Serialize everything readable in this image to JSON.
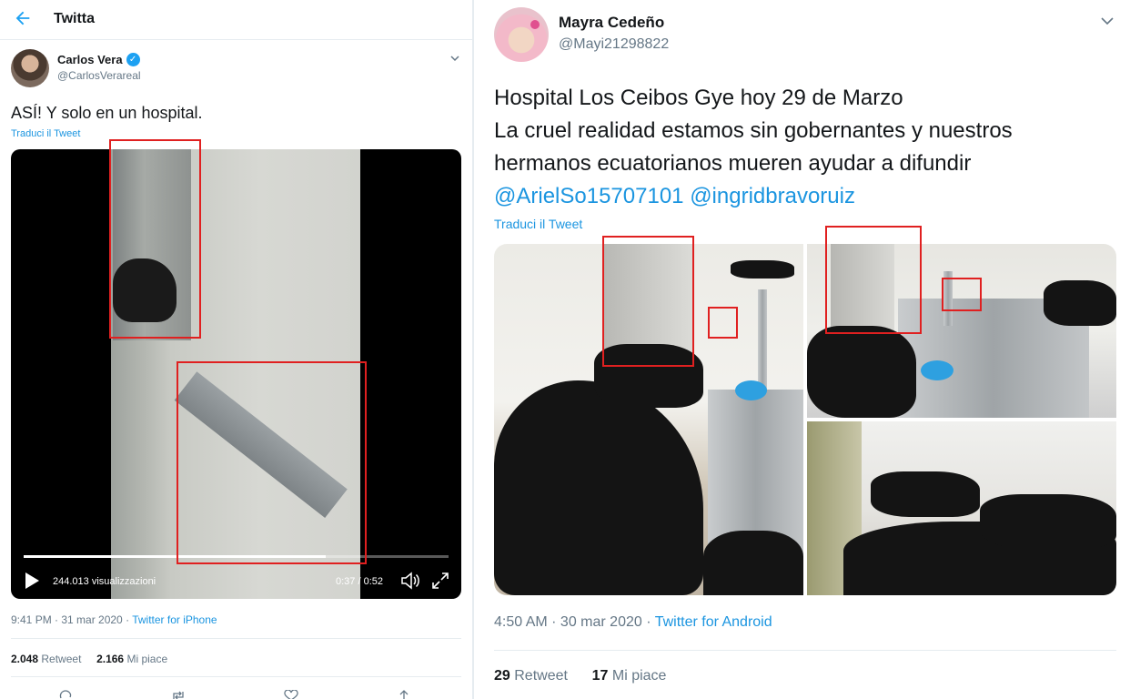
{
  "left": {
    "topbar": {
      "title": "Twitta"
    },
    "tweet": {
      "author_name": "Carlos Vera",
      "author_handle": "@CarlosVerareal",
      "text": "ASÍ! Y solo en un hospital.",
      "translate": "Traduci il Tweet",
      "video": {
        "views": "244.013 visualizzazioni",
        "time": "0:37 / 0:52",
        "progress": 0.71
      },
      "timestamp": "9:41 PM · 31 mar 2020 · ",
      "source": "Twitter for iPhone",
      "retweets": "2.048",
      "retweets_label": "Retweet",
      "likes": "2.166",
      "likes_label": "Mi piace"
    }
  },
  "right": {
    "tweet": {
      "author_name": "Mayra Cedeño",
      "author_handle": "@Mayi21298822",
      "line1": "Hospital Los Ceibos Gye hoy 29 de Marzo",
      "line2": "La cruel realidad estamos sin gobernantes y nuestros",
      "line3": "hermanos ecuatorianos mueren ayudar a difundir",
      "mention1": "@ArielSo15707101",
      "mention2": "@ingridbravoruiz",
      "translate": "Traduci il Tweet",
      "timestamp": "4:50 AM · 30 mar 2020 · ",
      "source": "Twitter for Android",
      "retweets": "29",
      "retweets_label": "Retweet",
      "likes": "17",
      "likes_label": "Mi piace"
    }
  },
  "colors": {
    "link": "#1b95e0",
    "highlight_box": "#e02020",
    "verified": "#1da1f2"
  },
  "icons": [
    "back-arrow-icon",
    "verified-badge-icon",
    "chevron-down-icon",
    "play-icon",
    "volume-icon",
    "fullscreen-icon",
    "reply-icon",
    "retweet-icon",
    "like-icon",
    "share-icon"
  ]
}
